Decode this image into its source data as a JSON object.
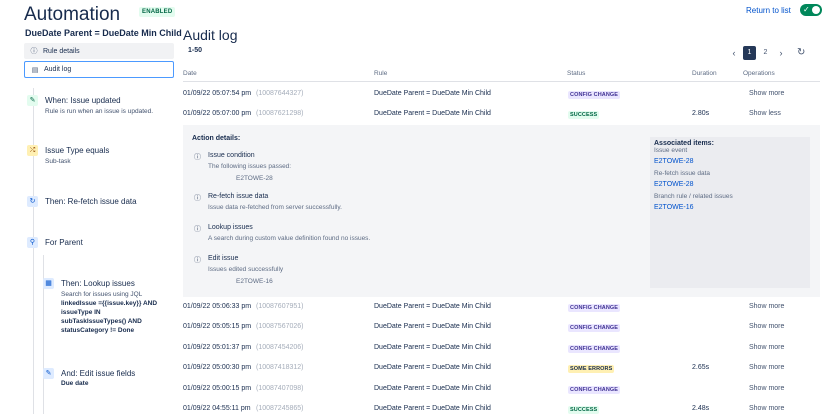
{
  "header": {
    "title": "Automation",
    "badge": "ENABLED",
    "return_link": "Return to list",
    "toggle_check": "✓"
  },
  "sidebar": {
    "rule_name": "DueDate Parent = DueDate Min Child",
    "nav": [
      {
        "label": "Rule details",
        "icon": "info-icon"
      },
      {
        "label": "Audit log",
        "icon": "document-icon"
      }
    ],
    "steps": [
      {
        "title": "When: Issue updated",
        "sub": "Rule is run when an issue is updated.",
        "icon": "pencil-icon"
      },
      {
        "title": "Issue Type equals",
        "sub": "Sub-task",
        "icon": "shuffle-icon"
      },
      {
        "title": "Then: Re-fetch issue data",
        "icon": "refresh-icon"
      },
      {
        "title": "For Parent",
        "icon": "hierarchy-icon"
      },
      {
        "title": "Then: Lookup issues",
        "sub": "Search for issues using JQL",
        "bold": [
          "linkedIssue ={{issue.key}} AND",
          "issueType IN",
          "subTaskIssueTypes() AND",
          "statusCategory != Done"
        ],
        "icon": "list-icon"
      },
      {
        "title": "And: Edit issue fields",
        "bold": [
          "Due date"
        ],
        "icon": "pencil-icon"
      }
    ]
  },
  "main": {
    "title": "Audit log",
    "range": "1-50",
    "pages": [
      "1",
      "2"
    ],
    "prev": "‹",
    "next": "›",
    "refresh": "↻",
    "columns": [
      "Date",
      "Rule",
      "Status",
      "Duration",
      "Operations"
    ],
    "rows": [
      {
        "date": "01/09/22 05:07:54 pm",
        "id": "(10087644327)",
        "rule": "DueDate Parent = DueDate Min Child",
        "status": "CONFIG CHANGE",
        "duration": "",
        "op": "Show more"
      },
      {
        "date": "01/09/22 05:07:00 pm",
        "id": "(10087621298)",
        "rule": "DueDate Parent = DueDate Min Child",
        "status": "SUCCESS",
        "duration": "2.80s",
        "op": "Show less"
      },
      {
        "date": "01/09/22 05:06:33 pm",
        "id": "(10087607951)",
        "rule": "DueDate Parent = DueDate Min Child",
        "status": "CONFIG CHANGE",
        "duration": "",
        "op": "Show more"
      },
      {
        "date": "01/09/22 05:05:15 pm",
        "id": "(10087567026)",
        "rule": "DueDate Parent = DueDate Min Child",
        "status": "CONFIG CHANGE",
        "duration": "",
        "op": "Show more"
      },
      {
        "date": "01/09/22 05:01:37 pm",
        "id": "(10087454206)",
        "rule": "DueDate Parent = DueDate Min Child",
        "status": "CONFIG CHANGE",
        "duration": "",
        "op": "Show more"
      },
      {
        "date": "01/09/22 05:00:30 pm",
        "id": "(10087418312)",
        "rule": "DueDate Parent = DueDate Min Child",
        "status": "SOME ERRORS",
        "duration": "2.65s",
        "op": "Show more"
      },
      {
        "date": "01/09/22 05:00:15 pm",
        "id": "(10087407098)",
        "rule": "DueDate Parent = DueDate Min Child",
        "status": "CONFIG CHANGE",
        "duration": "",
        "op": "Show more"
      },
      {
        "date": "01/09/22 04:55:11 pm",
        "id": "(10087245865)",
        "rule": "DueDate Parent = DueDate Min Child",
        "status": "SUCCESS",
        "duration": "2.48s",
        "op": "Show more"
      }
    ],
    "details": {
      "heading": "Action details:",
      "items": [
        {
          "title": "Issue condition",
          "sub": "The following issues passed:",
          "key": "E2TOWE-28"
        },
        {
          "title": "Re-fetch issue data",
          "sub": "Issue data re-fetched from server successfully."
        },
        {
          "title": "Lookup issues",
          "sub": "A search during custom value definition found no issues."
        },
        {
          "title": "Edit issue",
          "sub": "Issues edited successfully",
          "key": "E2TOWE-16"
        }
      ],
      "associated": {
        "heading": "Associated items:",
        "groups": [
          {
            "label": "Issue event",
            "key": "E2TOWE-28"
          },
          {
            "label": "Re-fetch issue data",
            "key": "E2TOWE-28"
          },
          {
            "label": "Branch rule / related issues",
            "key": "E2TOWE-16"
          }
        ]
      }
    }
  }
}
